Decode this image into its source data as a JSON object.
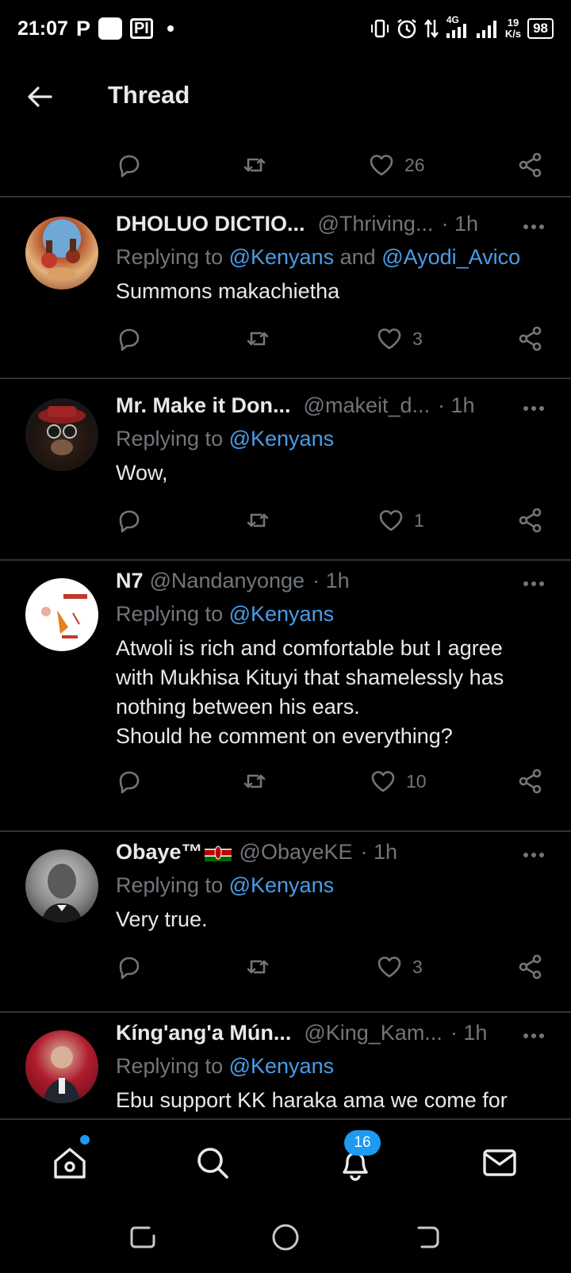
{
  "status_bar": {
    "time": "21:07",
    "network": "4G",
    "speed_value": "19",
    "speed_unit": "K/s",
    "battery": "98"
  },
  "header": {
    "title": "Thread"
  },
  "top_actions": {
    "likes": "26"
  },
  "tweets": [
    {
      "name": "DHOLUO DICTIO...",
      "handle": "@Thriving...",
      "time": "· 1h",
      "reply_prefix": "Replying to",
      "mentions": [
        "@Kenyans",
        "@Ayodi_Avico"
      ],
      "and_text": "and",
      "text": "Summons makachietha",
      "likes": "3"
    },
    {
      "name": "Mr. Make it Don...",
      "handle": "@makeit_d...",
      "time": "· 1h",
      "reply_prefix": "Replying to",
      "mentions": [
        "@Kenyans"
      ],
      "text": "Wow,",
      "likes": "1"
    },
    {
      "name": "N7",
      "handle": "@Nandanyonge",
      "time": "· 1h",
      "reply_prefix": "Replying to",
      "mentions": [
        "@Kenyans"
      ],
      "text_lines": [
        "Atwoli is rich and comfortable but I agree",
        "with Mukhisa Kituyi that shamelessly has",
        "nothing between his ears.",
        "Should he comment on everything?"
      ],
      "likes": "10"
    },
    {
      "name": "Obaye™",
      "handle": "@ObayeKE",
      "time": "· 1h",
      "reply_prefix": "Replying to",
      "mentions": [
        "@Kenyans"
      ],
      "text": "Very true.",
      "likes": "3"
    },
    {
      "name": "Kíng'ang'a Mún...",
      "handle": "@King_Kam...",
      "time": "· 1h",
      "reply_prefix": "Replying to",
      "mentions": [
        "@Kenyans"
      ],
      "text": "Ebu support KK haraka ama we come for"
    }
  ],
  "bottom_nav": {
    "notifications_badge": "16"
  },
  "colors": {
    "background": "#000000",
    "accent": "#1d9bf0",
    "mention": "#4a9de8",
    "muted": "#71767b",
    "divider": "#2f3336"
  },
  "icons": [
    "back-arrow-icon",
    "reply-icon",
    "retweet-icon",
    "heart-icon",
    "share-icon",
    "more-icon",
    "home-icon",
    "search-icon",
    "bell-icon",
    "mail-icon",
    "kenya-flag-icon"
  ]
}
